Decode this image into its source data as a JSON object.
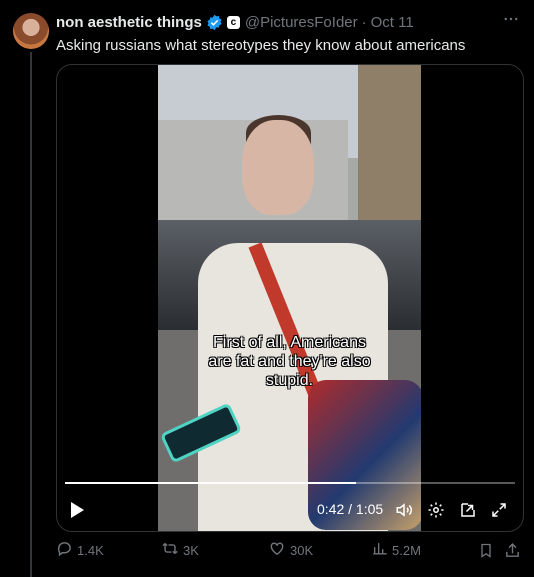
{
  "author": {
    "display_name": "non aesthetic things",
    "handle": "@PicturesFoIder",
    "affiliate_badge": "c",
    "time": "Oct 11",
    "separator": "·"
  },
  "tweet": {
    "text": "Asking russians what stereotypes they know about americans"
  },
  "video": {
    "caption_line1": "First of all, Americans",
    "caption_line2": "are fat and they're also",
    "caption_line3": "stupid.",
    "time_display": "0:42 / 1:05",
    "progress_fraction": 0.646
  },
  "actions": {
    "replies": "1.4K",
    "reposts": "3K",
    "likes": "30K",
    "views": "5.2M"
  },
  "icons": {
    "verified": "verified-badge-icon",
    "more": "more-icon",
    "play": "play-icon",
    "volume": "volume-icon",
    "settings": "settings-icon",
    "pip": "picture-in-picture-icon",
    "fullscreen": "fullscreen-icon",
    "reply": "reply-icon",
    "repost": "repost-icon",
    "like": "heart-icon",
    "views": "views-icon",
    "bookmark": "bookmark-icon",
    "share": "share-icon"
  },
  "colors": {
    "background": "#000000",
    "text": "#e7e9ea",
    "muted": "#71767b",
    "verified": "#1d9bf0",
    "border": "#2f3336"
  }
}
